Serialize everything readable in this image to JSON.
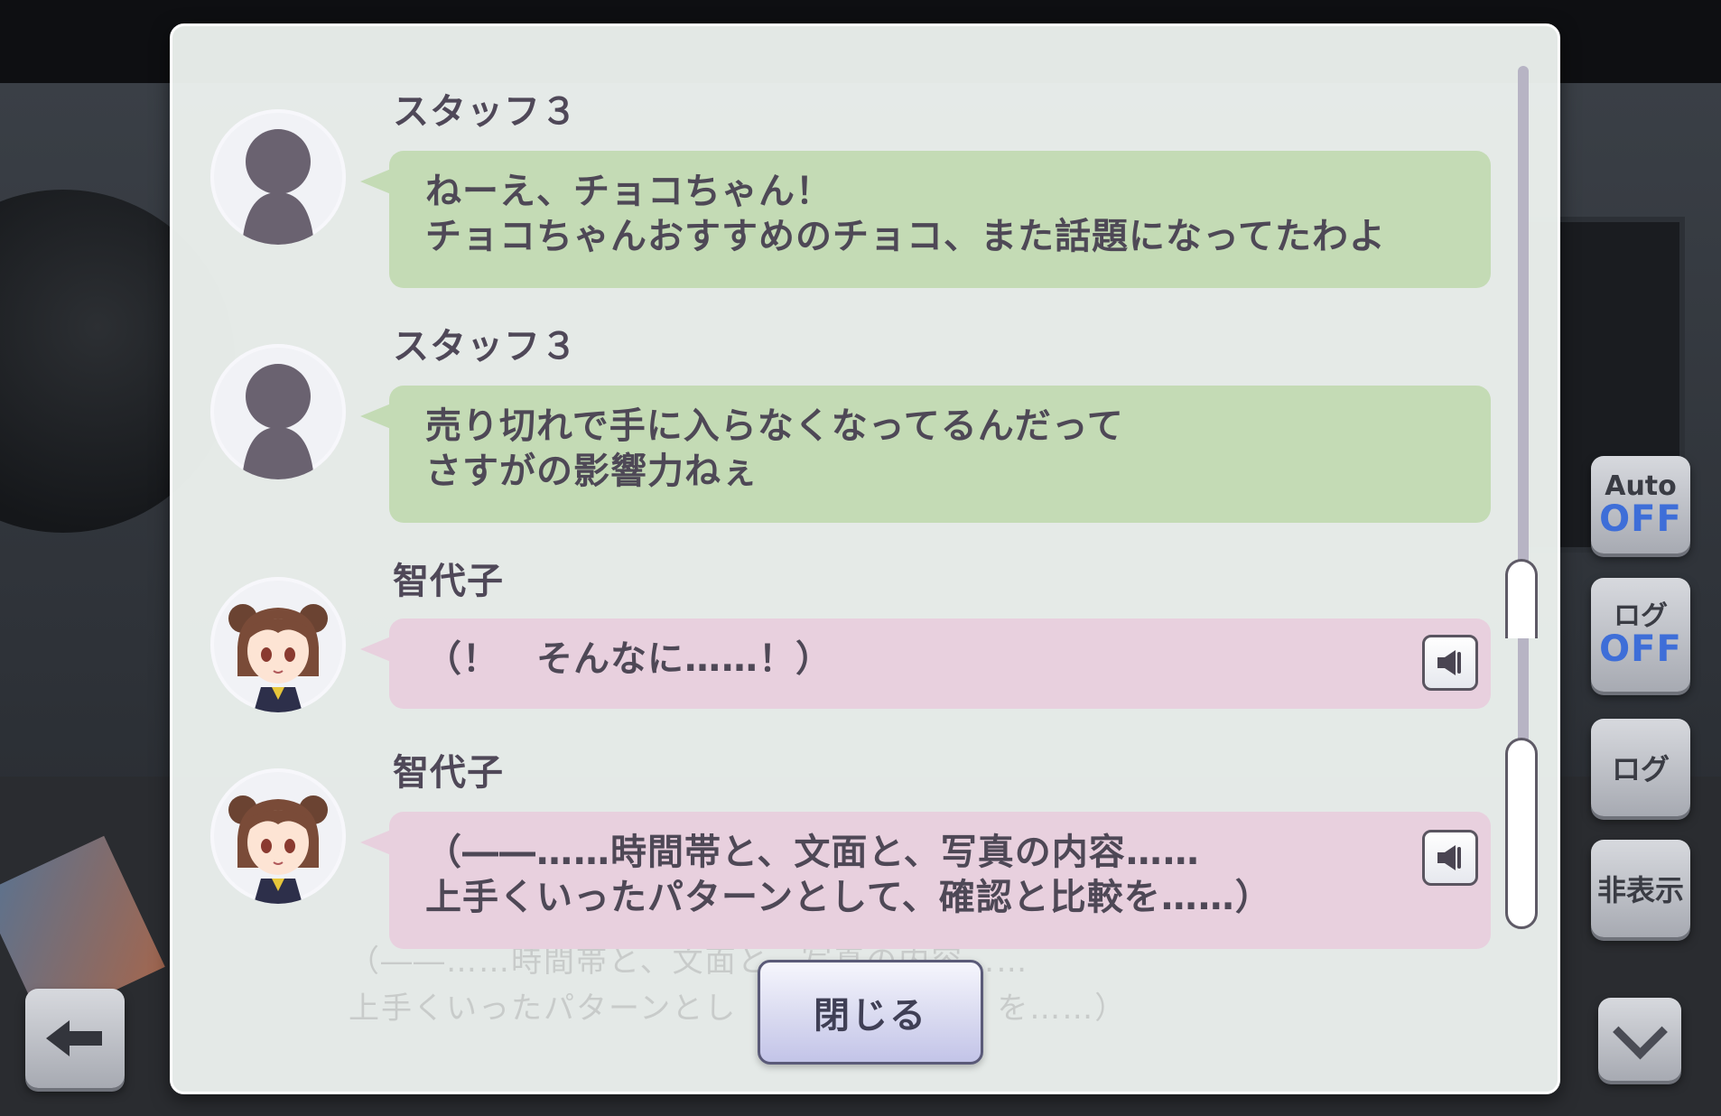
{
  "log": {
    "entries": [
      {
        "speaker": "スタッフ３",
        "avatar": "silhouette",
        "bubble_color": "green",
        "lines": [
          "ねーえ、チョコちゃん！",
          "チョコちゃんおすすめのチョコ、また話題になってたわよ"
        ],
        "has_voice": false
      },
      {
        "speaker": "スタッフ３",
        "avatar": "silhouette",
        "bubble_color": "green",
        "lines": [
          "売り切れで手に入らなくなってるんだって",
          "さすがの影響力ねぇ"
        ],
        "has_voice": false
      },
      {
        "speaker": "智代子",
        "avatar": "chiyoko",
        "bubble_color": "pink",
        "lines": [
          "（！　そんなに……！）"
        ],
        "has_voice": true
      },
      {
        "speaker": "智代子",
        "avatar": "chiyoko",
        "bubble_color": "pink",
        "lines": [
          "（――……時間帯と、文面と、写真の内容……",
          "上手くいったパターンとして、確認と比較を……）"
        ],
        "has_voice": true
      }
    ],
    "close_label": "閉じる"
  },
  "background_text": [
    "（――……時間帯と、文面と、写真の内容……",
    "上手くいったパターンとし",
    "を……）"
  ],
  "side_buttons": {
    "auto_label": "Auto",
    "auto_state": "OFF",
    "log_toggle_label": "ログ",
    "log_toggle_state": "OFF",
    "log_label": "ログ",
    "hide_label": "非表示"
  },
  "colors": {
    "green_bubble": "#c4dbb5",
    "pink_bubble": "#e8d0de",
    "off_state": "#3e6ed8"
  },
  "icons": {
    "voice": "speaker-icon",
    "back": "arrow-left-icon",
    "down": "chevron-down-icon"
  }
}
